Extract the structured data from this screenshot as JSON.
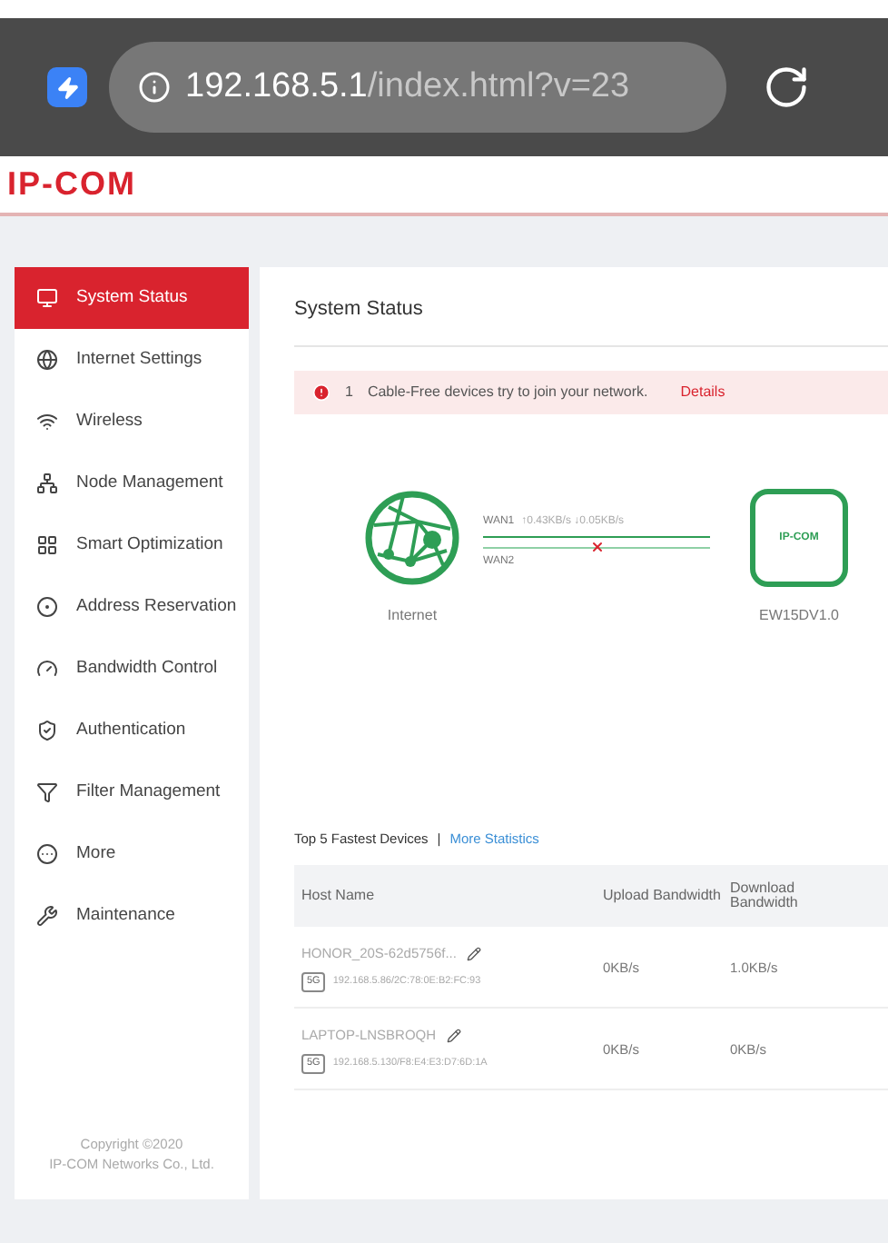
{
  "browser": {
    "url_host": "192.168.5.1",
    "url_path": "/index.html?v=23"
  },
  "header": {
    "logo": "IP-COM"
  },
  "sidebar": {
    "items": [
      {
        "label": "System Status",
        "selected": true
      },
      {
        "label": "Internet Settings",
        "selected": false
      },
      {
        "label": "Wireless",
        "selected": false
      },
      {
        "label": "Node Management",
        "selected": false
      },
      {
        "label": "Smart Optimization",
        "selected": false
      },
      {
        "label": "Address Reservation",
        "selected": false
      },
      {
        "label": "Bandwidth Control",
        "selected": false
      },
      {
        "label": "Authentication",
        "selected": false
      },
      {
        "label": "Filter Management",
        "selected": false
      },
      {
        "label": "More",
        "selected": false
      },
      {
        "label": "Maintenance",
        "selected": false
      }
    ],
    "copyright": [
      "Copyright ©2020",
      "IP-COM Networks Co., Ltd."
    ]
  },
  "page": {
    "title": "System Status",
    "alert": {
      "count": "1",
      "message": "Cable-Free devices try to join your network.",
      "link": "Details"
    },
    "topology": {
      "internet_label": "Internet",
      "wans": [
        {
          "name": "WAN1",
          "rate": "↑0.43KB/s ↓0.05KB/s",
          "connected": true
        },
        {
          "name": "WAN2",
          "connected": false
        }
      ],
      "device_logo": "IP-COM",
      "device_label": "EW15DV1.0"
    },
    "devices": {
      "title": "Top 5 Fastest Devices",
      "separator": "|",
      "link": "More Statistics",
      "columns": [
        "Host Name",
        "Upload Bandwidth",
        "Download Bandwidth"
      ],
      "rows": [
        {
          "host": "HONOR_20S-62d5756f...",
          "band": "5G",
          "address": "192.168.5.86/2C:78:0E:B2:FC:93",
          "upload": "0KB/s",
          "download": "1.0KB/s"
        },
        {
          "host": "LAPTOP-LNSBROQH",
          "band": "5G",
          "address": "192.168.5.130/F8:E4:E3:D7:6D:1A",
          "upload": "0KB/s",
          "download": "0KB/s"
        }
      ]
    }
  }
}
